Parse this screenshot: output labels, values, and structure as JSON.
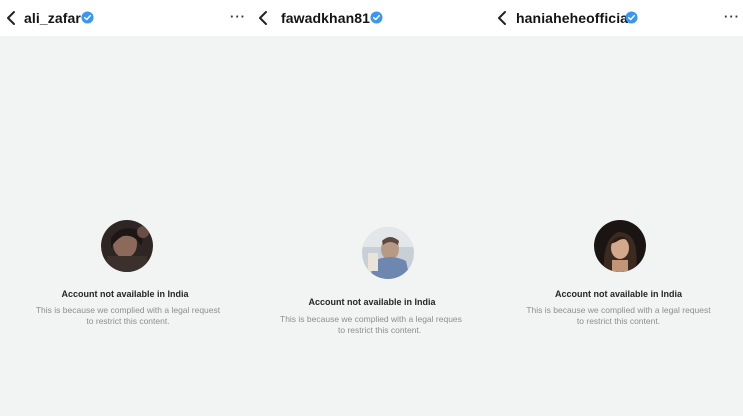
{
  "panels": [
    {
      "username": "ali_zafar",
      "message_title": "Account not available in India",
      "message_line1": "This is because we complied with a legal request",
      "message_line2": "to restrict this content."
    },
    {
      "username": "fawadkhan81",
      "message_title": "Account not available in India",
      "message_line1": "This is because we complied with a legal reques",
      "message_line2": "to restrict this content."
    },
    {
      "username": "haniaheheofficial",
      "message_title": "Account not available in India",
      "message_line1": "This is because we complied with a legal request",
      "message_line2": "to restrict this content."
    }
  ],
  "icons": {
    "back": "chevron-left-icon",
    "verified": "verified-badge-icon",
    "more": "more-options-icon"
  },
  "more_label": "···",
  "colors": {
    "verified_blue": "#3897f0",
    "background": "#f2f3f3",
    "title_text": "#262626",
    "secondary_text": "#8e8e8e"
  }
}
